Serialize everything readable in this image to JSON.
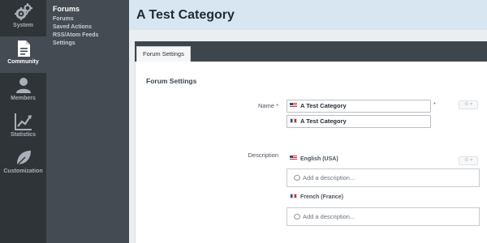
{
  "rail": {
    "items": [
      {
        "label": "System",
        "icon": "gears-icon"
      },
      {
        "label": "Community",
        "icon": "document-icon"
      },
      {
        "label": "Members",
        "icon": "user-icon"
      },
      {
        "label": "Statistics",
        "icon": "line-chart-icon"
      },
      {
        "label": "Customization",
        "icon": "leaf-icon"
      }
    ],
    "active_index": 1
  },
  "subnav": {
    "title": "Forums",
    "links": [
      "Forums",
      "Saved Actions",
      "RSS/Atom Feeds",
      "Settings"
    ]
  },
  "header": {
    "title": "A Test Category"
  },
  "tabs": [
    {
      "label": "Forum Settings"
    }
  ],
  "panel": {
    "title": "Forum Settings"
  },
  "name_field": {
    "label": "Name",
    "required_marker": "*",
    "value_en": "A Test Category",
    "value_fr": "A Test Category",
    "button_glyph": "⚙ ▾"
  },
  "description_field": {
    "label": "Description",
    "button_glyph": "⚙ ▾",
    "languages": [
      {
        "name": "English (USA)",
        "placeholder": "Add a description..."
      },
      {
        "name": "French (France)",
        "placeholder": "Add a description..."
      }
    ]
  },
  "colors": {
    "rail_bg": "#2f3439",
    "subnav_bg": "#454b52",
    "header_bg": "#d8e6f2",
    "tabbar_bg": "#3e464d"
  }
}
